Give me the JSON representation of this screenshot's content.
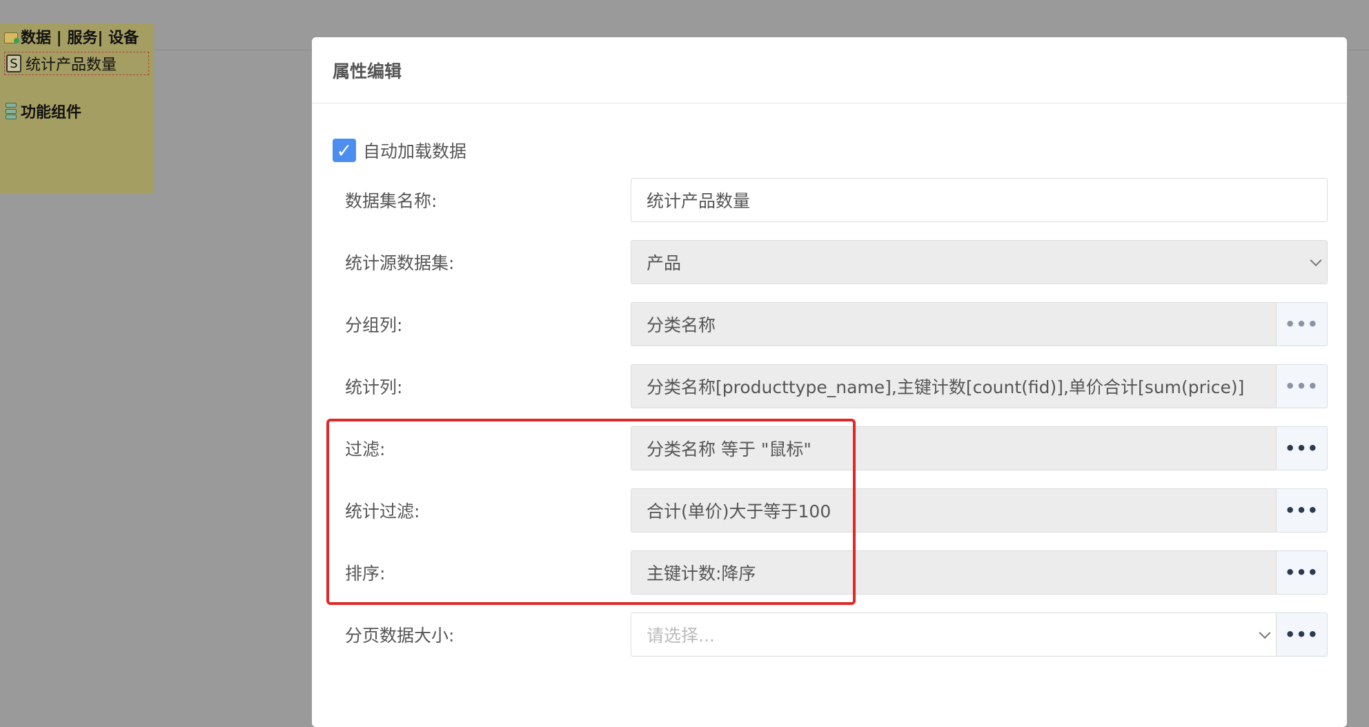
{
  "sidebar": {
    "group_title": "数据 | 服务| 设备",
    "item_label": "统计产品数量",
    "item_icon_glyph": "S",
    "group2_title": "功能组件"
  },
  "modal": {
    "title": "属性编辑",
    "auto_load": {
      "label": "自动加载数据",
      "checked": true,
      "check_glyph": "✓"
    },
    "fields": {
      "dataset_name": {
        "label": "数据集名称:",
        "value": "统计产品数量"
      },
      "source_dataset": {
        "label": "统计源数据集:",
        "value": "产品"
      },
      "group_by": {
        "label": "分组列:",
        "value": "分类名称"
      },
      "stat_columns": {
        "label": "统计列:",
        "value": "分类名称[producttype_name],主键计数[count(fid)],单价合计[sum(price)]"
      },
      "filter": {
        "label": "过滤:",
        "value": "分类名称 等于 \"鼠标\""
      },
      "stat_filter": {
        "label": "统计过滤:",
        "value": "合计(单价)大于等于100"
      },
      "sort": {
        "label": "排序:",
        "value": "主键计数:降序"
      },
      "page_size": {
        "label": "分页数据大小:",
        "placeholder": "请选择..."
      }
    },
    "more_button_label": "•••"
  },
  "colors": {
    "overlay": "#9a9a9a",
    "sidebar_bg": "#a59e63",
    "checkbox": "#4b8ef0",
    "highlight_box": "#e02828"
  },
  "icons": [
    "folder-icon",
    "script-s-icon",
    "layers-icon",
    "check-icon",
    "chevron-down-icon",
    "more-dots-icon"
  ]
}
